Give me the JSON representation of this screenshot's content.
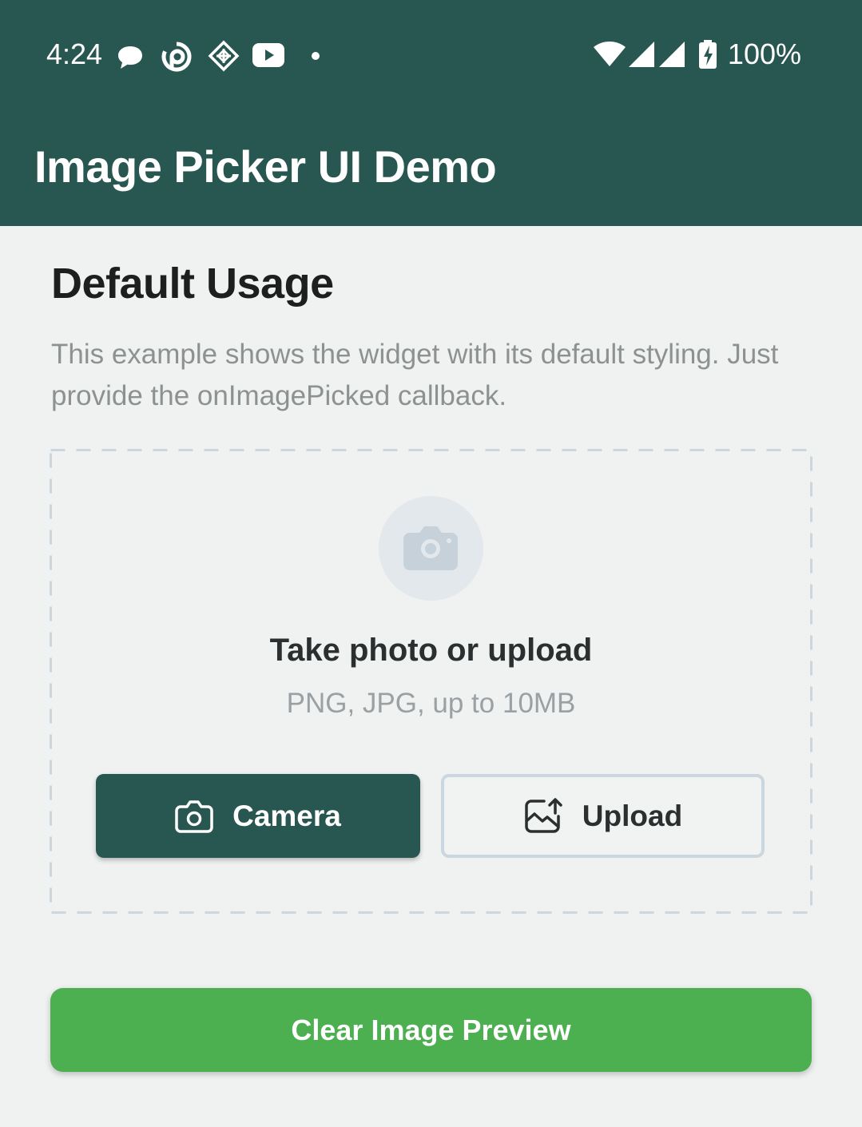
{
  "status_bar": {
    "time": "4:24",
    "battery": "100%",
    "icons": [
      "chat-bubble-icon",
      "sync-app-icon",
      "diamond-app-icon",
      "youtube-icon",
      "dot-icon",
      "wifi-icon",
      "signal-icon",
      "signal-icon",
      "battery-charging-icon"
    ]
  },
  "app_bar": {
    "title": "Image Picker UI Demo"
  },
  "section": {
    "title": "Default Usage",
    "description": "This example shows the widget with its default styling. Just provide the onImagePicked callback."
  },
  "picker": {
    "title": "Take photo or upload",
    "subtitle": "PNG, JPG, up to 10MB",
    "camera_label": "Camera",
    "upload_label": "Upload"
  },
  "clear_button": {
    "label": "Clear Image Preview"
  },
  "colors": {
    "app_bar": "#285752",
    "background": "#eff2f1",
    "clear_button": "#4caf50",
    "dashed_border": "#cbd6de"
  }
}
